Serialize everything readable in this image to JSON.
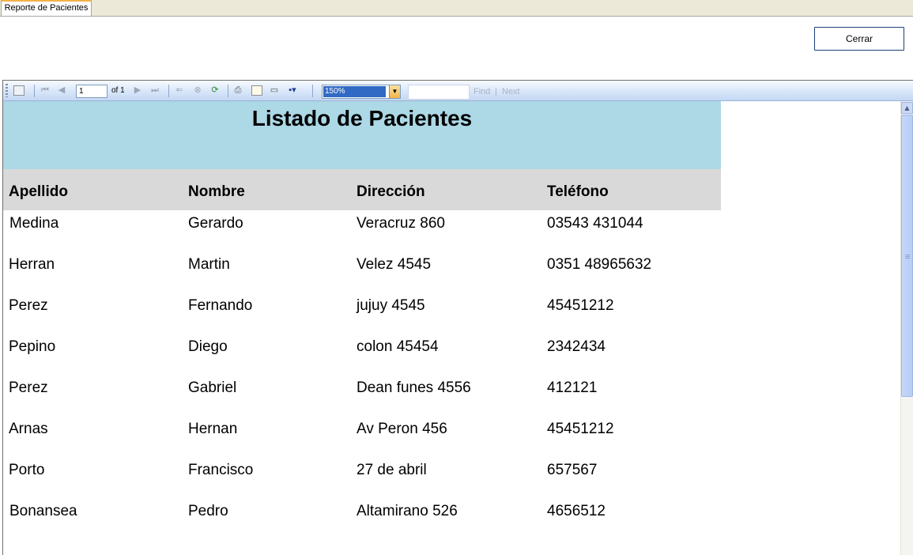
{
  "tab": {
    "label": "Reporte de Pacientes"
  },
  "panel": {
    "close_label": "Cerrar"
  },
  "toolbar": {
    "page_value": "1",
    "of_text": "of  1",
    "zoom": "150%",
    "find_label": "Find",
    "separator": "|",
    "next_label": "Next"
  },
  "report": {
    "title": "Listado de Pacientes",
    "columns": [
      "Apellido",
      "Nombre",
      "Dirección",
      "Teléfono"
    ],
    "rows": [
      [
        "Medina",
        "Gerardo",
        "Veracruz 860",
        "03543 431044"
      ],
      [
        "Herran",
        "Martin",
        "Velez 4545",
        "0351 48965632"
      ],
      [
        "Perez",
        "Fernando",
        "jujuy 4545",
        "45451212"
      ],
      [
        "Pepino",
        "Diego",
        "colon 45454",
        "2342434"
      ],
      [
        "Perez",
        "Gabriel",
        "Dean funes 4556",
        "412121"
      ],
      [
        "Arnas",
        "Hernan",
        "Av Peron 456",
        "45451212"
      ],
      [
        "Porto",
        "Francisco",
        "27 de abril",
        "657567"
      ],
      [
        "Bonansea",
        "Pedro",
        "Altamirano 526",
        "4656512"
      ]
    ]
  },
  "colors": {
    "title_band": "#add8e6",
    "header_band": "#d9d9d9",
    "zoom_selection": "#316ac5"
  }
}
